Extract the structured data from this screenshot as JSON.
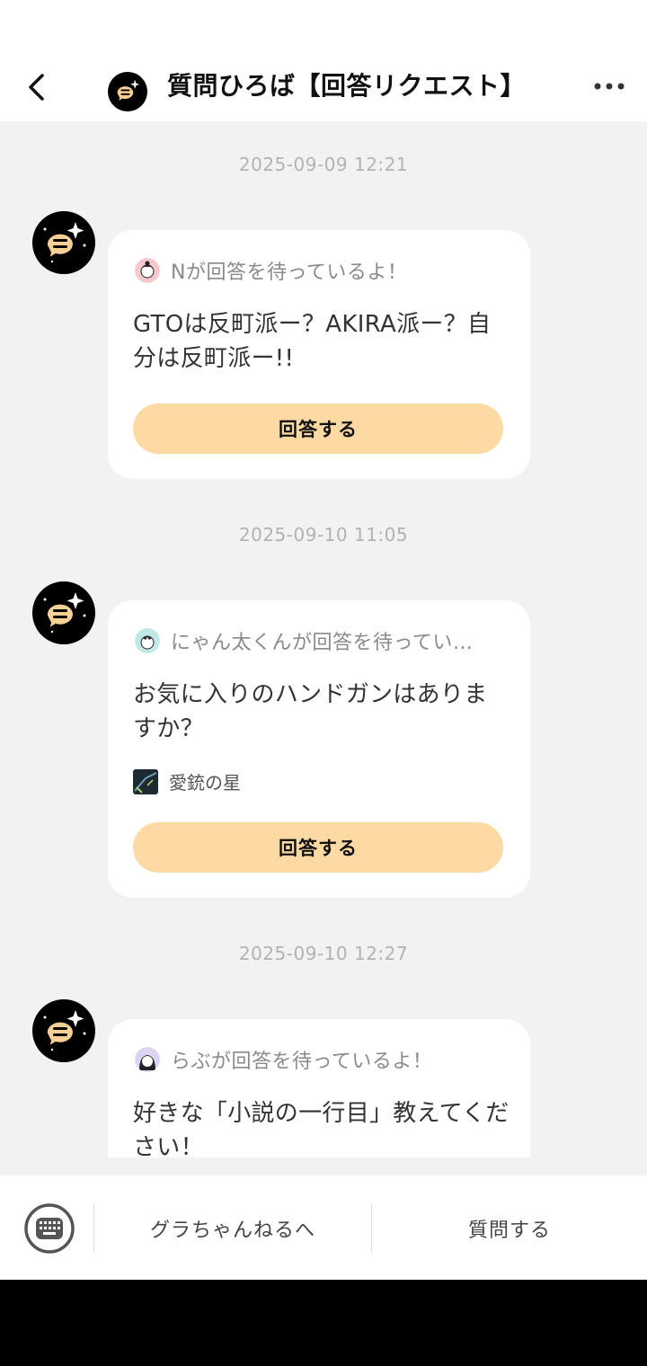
{
  "header": {
    "title": "質問ひろば【回答リクエスト】"
  },
  "messages": [
    {
      "timestamp": "2025-09-09 12:21",
      "requester_text": "Nが回答を待っているよ！",
      "question": "GTOは反町派ー？AKIRA派ー？自分は反町派ー!!",
      "answer_label": "回答する"
    },
    {
      "timestamp": "2025-09-10 11:05",
      "requester_text": "にゃん太くんが回答を待ってい…",
      "question": "お気に入りのハンドガンはありますか？",
      "tag": "愛銃の星",
      "answer_label": "回答する"
    },
    {
      "timestamp": "2025-09-10 12:27",
      "requester_text": "らぶが回答を待っているよ！",
      "question": "好きな「小説の一行目」教えてください！"
    }
  ],
  "bottombar": {
    "left_label": "グラちゃんねるへ",
    "right_label": "質問する"
  },
  "colors": {
    "answer_button": "#fdd9a3",
    "background": "#f2f2f2",
    "timestamp": "#b3b3b3"
  }
}
